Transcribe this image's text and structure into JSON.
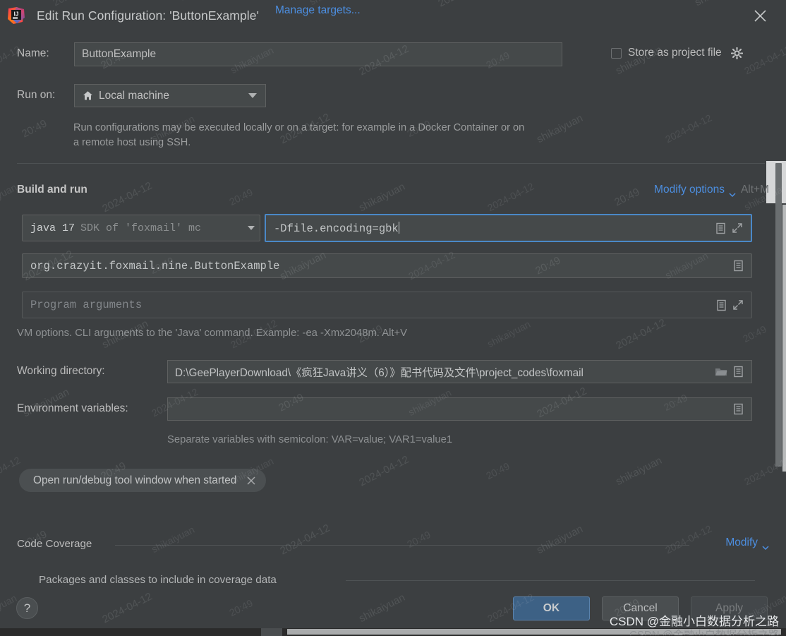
{
  "window": {
    "title": "Edit Run Configuration: 'ButtonExample'",
    "logo_alt": "intellij-idea-logo",
    "close_label": "×"
  },
  "form": {
    "name_label": "Name:",
    "name_value": "ButtonExample",
    "store_as_project_file_label": "Store as project file",
    "store_as_project_file_checked": false,
    "run_on_label": "Run on:",
    "run_on_value": "Local machine",
    "manage_targets_link": "Manage targets...",
    "description": "Run configurations may be executed locally or on a target: for example in a Docker Container or on a remote host using SSH."
  },
  "build_and_run": {
    "section_title": "Build and run",
    "modify_options_label": "Modify options",
    "modify_options_shortcut": "Alt+M",
    "jdk_main": "java 17",
    "jdk_sub": "SDK of 'foxmail' mc",
    "vm_options_value": "-Dfile.encoding=gbk",
    "main_class_value": "org.crazyit.foxmail.nine.ButtonExample",
    "program_arguments_placeholder": "Program arguments",
    "vm_options_hint": "VM options. CLI arguments to the 'Java' command. Example: -ea -Xmx2048m. Alt+V"
  },
  "paths": {
    "working_directory_label": "Working directory:",
    "working_directory_value": "D:\\GeePlayerDownload\\《疯狂Java讲义（6）》配书代码及文件\\project_codes\\foxmail",
    "environment_variables_label": "Environment variables:",
    "environment_variables_value": "",
    "environment_variables_hint": "Separate variables with semicolon: VAR=value; VAR1=value1"
  },
  "chip": {
    "label": "Open run/debug tool window when started",
    "remove_label": "×"
  },
  "code_coverage": {
    "section_title": "Code Coverage",
    "modify_label": "Modify",
    "sub_section_title": "Packages and classes to include in coverage data"
  },
  "buttons": {
    "help": "?",
    "ok": "OK",
    "cancel": "Cancel",
    "apply": "Apply"
  },
  "watermarks": {
    "csdn": "CSDN @金融小白数据分析之路",
    "tile_a": "shikaiyuan",
    "tile_b": "2024-04-12",
    "tile_c": "20:49"
  },
  "colors": {
    "dialog_bg": "#3c3f41",
    "field_bg": "#45494a",
    "accent_link": "#4c8ee0",
    "focus_border": "#4a88c7",
    "primary_button": "#3d6185",
    "text": "#bbbbbb"
  }
}
